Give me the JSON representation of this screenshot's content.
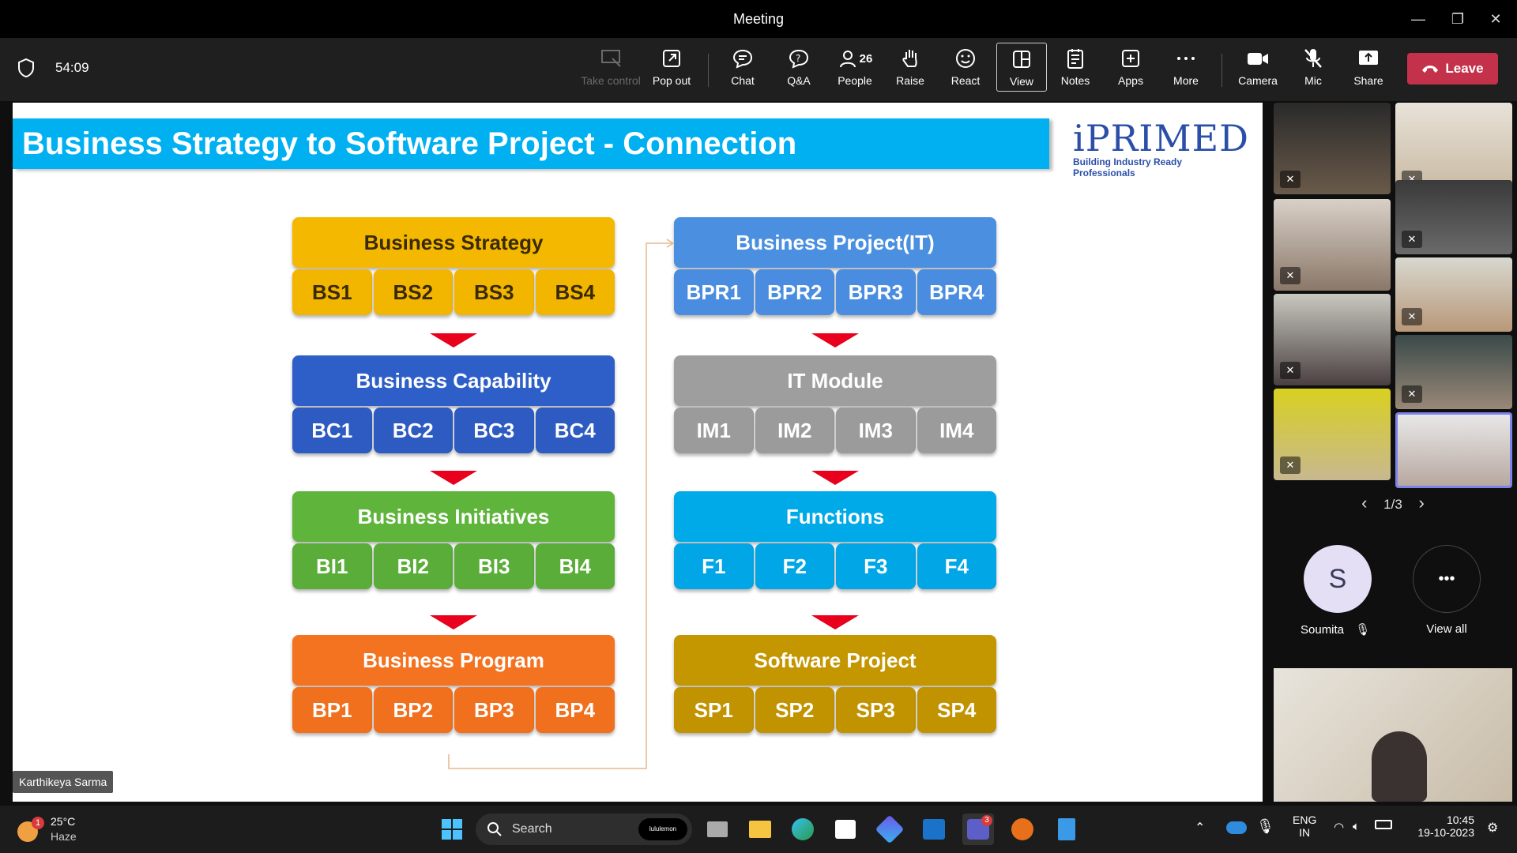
{
  "window": {
    "title": "Meeting",
    "minimize": "—",
    "restore": "❐",
    "close": "✕"
  },
  "call": {
    "timer": "54:09"
  },
  "toolbar": {
    "take_control": "Take control",
    "pop_out": "Pop out",
    "chat": "Chat",
    "qa": "Q&A",
    "people": "People",
    "people_count": "26",
    "raise": "Raise",
    "react": "React",
    "view": "View",
    "notes": "Notes",
    "apps": "Apps",
    "more": "More",
    "camera": "Camera",
    "mic": "Mic",
    "share": "Share",
    "leave": "Leave"
  },
  "slide": {
    "title": "Business Strategy to Software Project - Connection",
    "logo": {
      "brand": "iPRIMED",
      "tagline": "Building Industry Ready Professionals"
    },
    "left_blocks": [
      {
        "title": "Business Strategy",
        "cells": [
          "BS1",
          "BS2",
          "BS3",
          "BS4"
        ],
        "head_color": "#f5b800",
        "cell_color": "#f2b500",
        "text_color": "#3a2a00"
      },
      {
        "title": "Business Capability",
        "cells": [
          "BC1",
          "BC2",
          "BC3",
          "BC4"
        ],
        "head_color": "#2e5fc9",
        "cell_color": "#2d5bc2",
        "text_color": "#ffffff"
      },
      {
        "title": "Business Initiatives",
        "cells": [
          "BI1",
          "BI2",
          "BI3",
          "BI4"
        ],
        "head_color": "#5fb43c",
        "cell_color": "#5aad38",
        "text_color": "#ffffff"
      },
      {
        "title": "Business Program",
        "cells": [
          "BP1",
          "BP2",
          "BP3",
          "BP4"
        ],
        "head_color": "#f47320",
        "cell_color": "#f0701d",
        "text_color": "#ffffff"
      }
    ],
    "right_blocks": [
      {
        "title": "Business Project(IT)",
        "cells": [
          "BPR1",
          "BPR2",
          "BPR3",
          "BPR4"
        ],
        "head_color": "#4a8fe0",
        "cell_color": "#4a8de0",
        "text_color": "#ffffff"
      },
      {
        "title": "IT Module",
        "cells": [
          "IM1",
          "IM2",
          "IM3",
          "IM4"
        ],
        "head_color": "#9e9e9e",
        "cell_color": "#9b9b9b",
        "text_color": "#ffffff"
      },
      {
        "title": "Functions",
        "cells": [
          "F1",
          "F2",
          "F3",
          "F4"
        ],
        "head_color": "#00a9e8",
        "cell_color": "#00a6e6",
        "text_color": "#ffffff"
      },
      {
        "title": "Software Project",
        "cells": [
          "SP1",
          "SP2",
          "SP3",
          "SP4"
        ],
        "head_color": "#c49600",
        "cell_color": "#c19300",
        "text_color": "#ffffff"
      }
    ],
    "presenter_name": "Karthikeya Sarma"
  },
  "participants": {
    "page": "1/3",
    "prev": "‹",
    "next": "›",
    "overflow_person": {
      "initial": "S",
      "name": "Soumita"
    },
    "view_all": "View all",
    "view_all_icon": "•••"
  },
  "taskbar": {
    "weather_temp": "25°C",
    "weather_desc": "Haze",
    "weather_badge": "1",
    "search_label": "Search",
    "search_chip": "lululemon",
    "lang_1": "ENG",
    "lang_2": "IN",
    "time": "10:45",
    "date": "19-10-2023",
    "teams_badge": "3"
  },
  "colors": {
    "accent": "#c4314b",
    "slide_banner": "#00b0f0",
    "arrow": "#e8001c"
  }
}
